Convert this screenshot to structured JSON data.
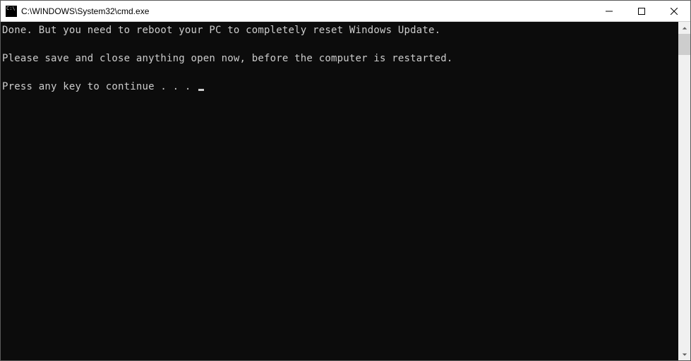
{
  "window": {
    "title": "C:\\WINDOWS\\System32\\cmd.exe"
  },
  "console": {
    "line1": "Done. But you need to reboot your PC to completely reset Windows Update.",
    "line2": "Please save and close anything open now, before the computer is restarted.",
    "line3": "Press any key to continue . . . "
  }
}
